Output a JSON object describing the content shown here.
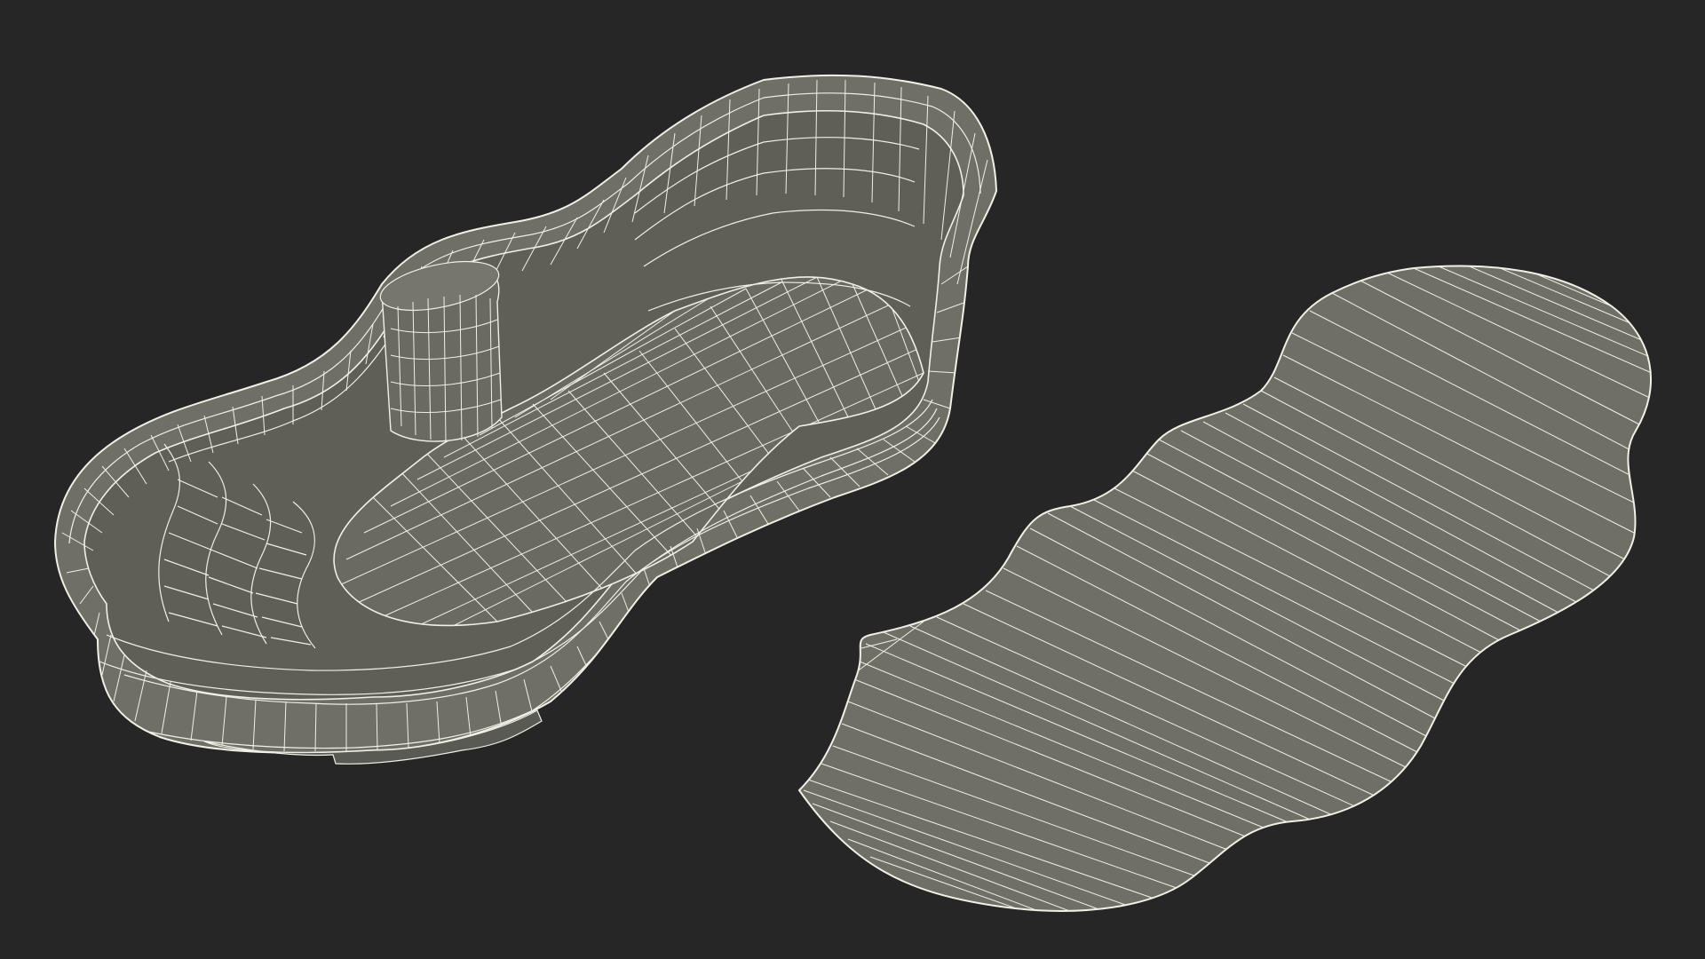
{
  "scene": {
    "background_color": "#262626",
    "mesh_fill_color": "#6f6f66",
    "mesh_inner_fill_color": "#5f5f58",
    "mesh_shadow_color": "#4a4a45",
    "wire_color": "#f0f0e6",
    "objects": [
      {
        "name": "pool-shell-wireframe",
        "description_visible": false
      },
      {
        "name": "pool-cover-wireframe",
        "description_visible": false
      }
    ]
  }
}
